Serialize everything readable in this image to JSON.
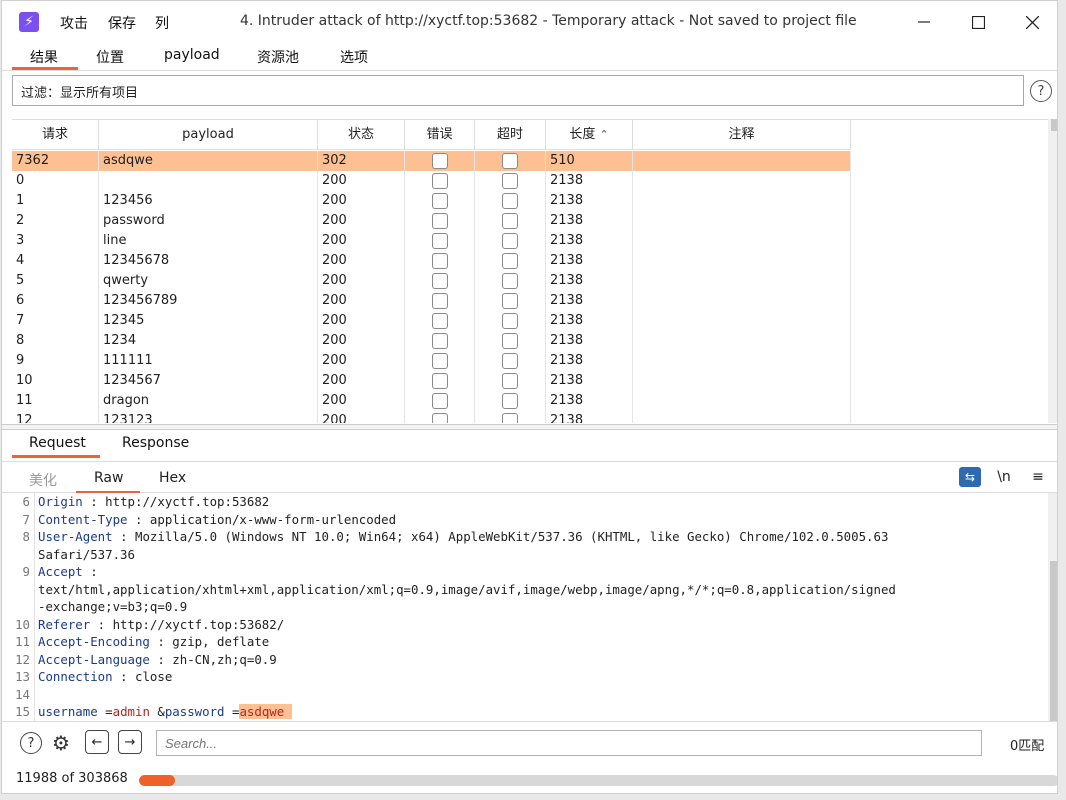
{
  "app": {
    "logo_glyph": "⚡",
    "menu": [
      "攻击",
      "保存",
      "列"
    ],
    "title": "4. Intruder attack of http://xyctf.top:53682 - Temporary attack - Not saved to project file"
  },
  "tabs": [
    "结果",
    "位置",
    "payload",
    "资源池",
    "选项"
  ],
  "filter": {
    "text": "过滤：显示所有项目"
  },
  "table": {
    "columns": [
      "请求",
      "payload",
      "状态",
      "错误",
      "超时",
      "长度",
      "注释"
    ],
    "sort_column": "长度",
    "sort_indicator": "^",
    "rows": [
      {
        "req": "7362",
        "payload": "asdqwe",
        "status": "302",
        "error": false,
        "timeout": false,
        "length": "510",
        "comment": "",
        "selected": true
      },
      {
        "req": "0",
        "payload": "",
        "status": "200",
        "error": false,
        "timeout": false,
        "length": "2138",
        "comment": ""
      },
      {
        "req": "1",
        "payload": "123456",
        "status": "200",
        "error": false,
        "timeout": false,
        "length": "2138",
        "comment": ""
      },
      {
        "req": "2",
        "payload": "password",
        "status": "200",
        "error": false,
        "timeout": false,
        "length": "2138",
        "comment": ""
      },
      {
        "req": "3",
        "payload": "line",
        "status": "200",
        "error": false,
        "timeout": false,
        "length": "2138",
        "comment": ""
      },
      {
        "req": "4",
        "payload": "12345678",
        "status": "200",
        "error": false,
        "timeout": false,
        "length": "2138",
        "comment": ""
      },
      {
        "req": "5",
        "payload": "qwerty",
        "status": "200",
        "error": false,
        "timeout": false,
        "length": "2138",
        "comment": ""
      },
      {
        "req": "6",
        "payload": "123456789",
        "status": "200",
        "error": false,
        "timeout": false,
        "length": "2138",
        "comment": ""
      },
      {
        "req": "7",
        "payload": "12345",
        "status": "200",
        "error": false,
        "timeout": false,
        "length": "2138",
        "comment": ""
      },
      {
        "req": "8",
        "payload": "1234",
        "status": "200",
        "error": false,
        "timeout": false,
        "length": "2138",
        "comment": ""
      },
      {
        "req": "9",
        "payload": "111111",
        "status": "200",
        "error": false,
        "timeout": false,
        "length": "2138",
        "comment": ""
      },
      {
        "req": "10",
        "payload": "1234567",
        "status": "200",
        "error": false,
        "timeout": false,
        "length": "2138",
        "comment": ""
      },
      {
        "req": "11",
        "payload": "dragon",
        "status": "200",
        "error": false,
        "timeout": false,
        "length": "2138",
        "comment": ""
      },
      {
        "req": "12",
        "payload": "123123",
        "status": "200",
        "error": false,
        "timeout": false,
        "length": "2138",
        "comment": ""
      }
    ]
  },
  "detail_tabs": [
    "Request",
    "Response"
  ],
  "view_tabs": [
    "美化",
    "Raw",
    "Hex"
  ],
  "view_icons": {
    "newline_label": "\\n"
  },
  "request_lines": [
    {
      "n": "6",
      "parts": [
        {
          "t": "Origin",
          "c": "key"
        },
        {
          "t": " : http://xyctf.top:53682",
          "c": "val"
        }
      ]
    },
    {
      "n": "7",
      "parts": [
        {
          "t": "Content-Type",
          "c": "key"
        },
        {
          "t": " : application/x-www-form-urlencoded",
          "c": "val"
        }
      ]
    },
    {
      "n": "8",
      "parts": [
        {
          "t": "User-Agent",
          "c": "key"
        },
        {
          "t": " : Mozilla/5.0 (Windows NT 10.0; Win64; x64) AppleWebKit/537.36 (KHTML, like Gecko) Chrome/102.0.5005.63",
          "c": "val"
        }
      ]
    },
    {
      "n": "",
      "parts": [
        {
          "t": "Safari/537.36",
          "c": "val"
        }
      ]
    },
    {
      "n": "9",
      "parts": [
        {
          "t": "Accept",
          "c": "key"
        },
        {
          "t": " :",
          "c": "val"
        }
      ]
    },
    {
      "n": "",
      "parts": [
        {
          "t": "text/html,application/xhtml+xml,application/xml;q=0.9,image/avif,image/webp,image/apng,*/*;q=0.8,application/signed",
          "c": "val"
        }
      ]
    },
    {
      "n": "",
      "parts": [
        {
          "t": "-exchange;v=b3;q=0.9",
          "c": "val"
        }
      ]
    },
    {
      "n": "10",
      "parts": [
        {
          "t": "Referer",
          "c": "key"
        },
        {
          "t": " : http://xyctf.top:53682/",
          "c": "val"
        }
      ]
    },
    {
      "n": "11",
      "parts": [
        {
          "t": "Accept-Encoding",
          "c": "key"
        },
        {
          "t": " : gzip, deflate",
          "c": "val"
        }
      ]
    },
    {
      "n": "12",
      "parts": [
        {
          "t": "Accept-Language",
          "c": "key"
        },
        {
          "t": " : zh-CN,zh;q=0.9",
          "c": "val"
        }
      ]
    },
    {
      "n": "13",
      "parts": [
        {
          "t": "Connection",
          "c": "key"
        },
        {
          "t": " : close",
          "c": "val"
        }
      ]
    },
    {
      "n": "14",
      "parts": []
    },
    {
      "n": "15",
      "parts": [
        {
          "t": "username",
          "c": "key"
        },
        {
          "t": " =",
          "c": "val"
        },
        {
          "t": "admin",
          "c": "pval"
        },
        {
          "t": " &",
          "c": "val"
        },
        {
          "t": "password",
          "c": "key"
        },
        {
          "t": " =",
          "c": "val"
        },
        {
          "t": "asdqwe ",
          "c": "pval hl"
        }
      ]
    }
  ],
  "search": {
    "placeholder": "Search..."
  },
  "match_count": "0匹配",
  "status": {
    "progress_text": "11988 of 303868",
    "progress_fraction": 0.0395,
    "progress_color": "#f0602a"
  },
  "colors": {
    "accent": "#e8653a",
    "selected_row": "#fdc092",
    "logo": "#7b4ff2"
  }
}
